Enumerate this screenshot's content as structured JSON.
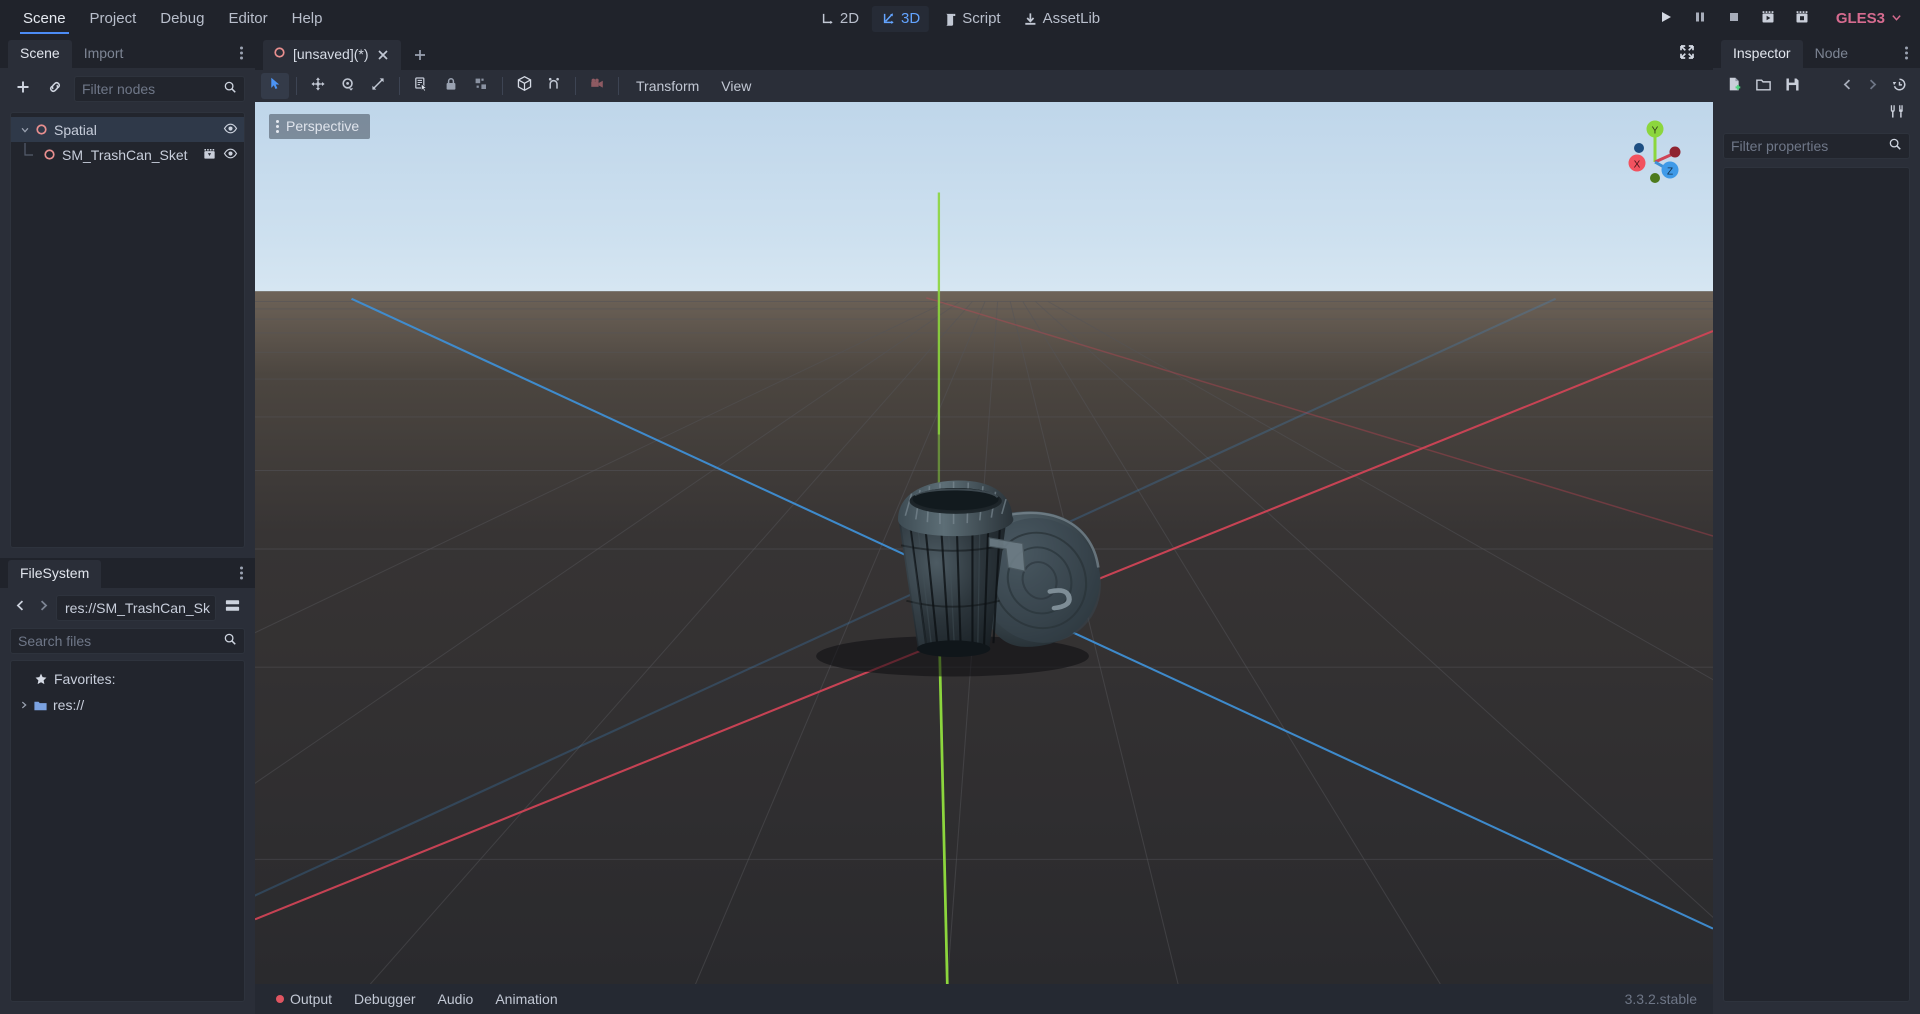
{
  "menu": {
    "items": [
      {
        "label": "Scene",
        "active": true
      },
      {
        "label": "Project",
        "active": false
      },
      {
        "label": "Debug",
        "active": false
      },
      {
        "label": "Editor",
        "active": false
      },
      {
        "label": "Help",
        "active": false
      }
    ]
  },
  "center_tools": [
    {
      "label": "2D",
      "icon": "2d-icon",
      "active": false
    },
    {
      "label": "3D",
      "icon": "3d-icon",
      "active": true
    },
    {
      "label": "Script",
      "icon": "script-icon",
      "active": false
    },
    {
      "label": "AssetLib",
      "icon": "assetlib-icon",
      "active": false
    }
  ],
  "playback": {
    "buttons": [
      {
        "name": "play-button",
        "icon": "play-icon"
      },
      {
        "name": "pause-button",
        "icon": "pause-icon"
      },
      {
        "name": "stop-button",
        "icon": "stop-icon"
      },
      {
        "name": "play-scene-button",
        "icon": "play-scene-icon"
      },
      {
        "name": "play-custom-scene-button",
        "icon": "play-custom-scene-icon"
      }
    ],
    "renderer": "GLES3",
    "renderer_color": "#d66b8f"
  },
  "scene_dock": {
    "tabs": [
      {
        "label": "Scene",
        "active": true
      },
      {
        "label": "Import",
        "active": false
      }
    ],
    "toolbar": {
      "add_node_label": "+",
      "instance_label": "link",
      "filter_placeholder": "Filter nodes"
    },
    "tree": [
      {
        "label": "Spatial",
        "depth": 0,
        "selected": true,
        "expanded": true,
        "has_children": true,
        "icons": [
          "visibility-icon"
        ]
      },
      {
        "label": "SM_TrashCan_Sket",
        "depth": 1,
        "selected": false,
        "expanded": false,
        "has_children": false,
        "icons": [
          "scene-instance-icon",
          "visibility-icon"
        ]
      }
    ]
  },
  "filesystem_dock": {
    "tabs": [
      {
        "label": "FileSystem",
        "active": true
      }
    ],
    "path_value": "res://SM_TrashCan_Sk",
    "search_placeholder": "Search files",
    "tree": [
      {
        "label": "Favorites:",
        "icon": "star-icon",
        "depth": 0,
        "expandable": false
      },
      {
        "label": "res://",
        "icon": "folder-icon",
        "depth": 0,
        "expandable": true
      }
    ]
  },
  "editor_tabs": {
    "tabs": [
      {
        "label": "[unsaved](*)",
        "active": true,
        "modified": true
      }
    ],
    "add_tab_label": "+"
  },
  "viewport": {
    "toolbar": {
      "tools": [
        {
          "name": "select-mode-button",
          "icon": "cursor-icon",
          "active": true
        },
        {
          "name": "move-mode-button",
          "icon": "move-icon",
          "active": false
        },
        {
          "name": "rotate-mode-button",
          "icon": "rotate-icon",
          "active": false
        },
        {
          "name": "scale-mode-button",
          "icon": "scale-icon",
          "active": false
        },
        {
          "name": "list-select-button",
          "icon": "list-select-icon",
          "active": false
        },
        {
          "name": "lock-selection-button",
          "icon": "lock-icon",
          "active": false
        },
        {
          "name": "group-selection-button",
          "icon": "group-icon",
          "active": false
        },
        {
          "name": "use-local-space-button",
          "icon": "cube-icon",
          "active": false
        },
        {
          "name": "snap-mode-button",
          "icon": "snap-icon",
          "active": false
        },
        {
          "name": "preview-camera-button",
          "icon": "camera-icon",
          "active": false
        }
      ],
      "menus": [
        {
          "label": "Transform"
        },
        {
          "label": "View"
        }
      ]
    },
    "perspective_label": "Perspective",
    "gizmo_axes": [
      {
        "label": "X",
        "color": "#fc5f5f"
      },
      {
        "label": "Y",
        "color": "#8bd942"
      },
      {
        "label": "Z",
        "color": "#4aa5f0"
      }
    ],
    "scene_object": "trash-can-model"
  },
  "bottom_panel": {
    "tabs": [
      {
        "label": "Output",
        "has_indicator": true
      },
      {
        "label": "Debugger",
        "has_indicator": false
      },
      {
        "label": "Audio",
        "has_indicator": false
      },
      {
        "label": "Animation",
        "has_indicator": false
      }
    ],
    "version": "3.3.2.stable"
  },
  "inspector": {
    "tabs": [
      {
        "label": "Inspector",
        "active": true
      },
      {
        "label": "Node",
        "active": false
      }
    ],
    "toolbar": [
      {
        "name": "new-resource-button",
        "icon": "new-resource-icon"
      },
      {
        "name": "load-resource-button",
        "icon": "open-folder-icon"
      },
      {
        "name": "save-resource-button",
        "icon": "save-icon"
      },
      {
        "name": "history-previous-button",
        "icon": "chevron-left-icon"
      },
      {
        "name": "history-next-button",
        "icon": "chevron-right-icon"
      },
      {
        "name": "history-button",
        "icon": "history-icon"
      },
      {
        "name": "object-menu-button",
        "icon": "tools-icon"
      }
    ],
    "filter_placeholder": "Filter properties"
  }
}
